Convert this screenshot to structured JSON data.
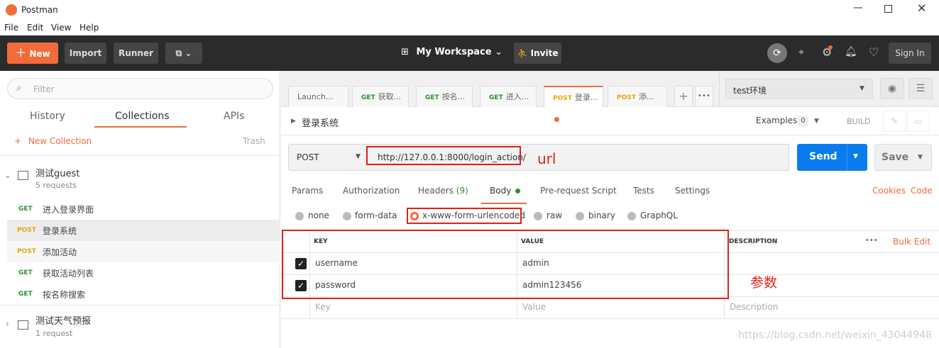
{
  "window": {
    "title": "Postman"
  },
  "menu": [
    "File",
    "Edit",
    "View",
    "Help"
  ],
  "header": {
    "new_label": "New",
    "import_label": "Import",
    "runner_label": "Runner",
    "workspace_label": "My Workspace",
    "invite_label": "Invite",
    "signin_label": "Sign In"
  },
  "sidebar": {
    "filter_placeholder": "Filter",
    "tabs": [
      "History",
      "Collections",
      "APIs"
    ],
    "new_collection": "New Collection",
    "trash": "Trash",
    "collections": [
      {
        "name": "测试guest",
        "count": "5 requests"
      },
      {
        "name": "测试天气预报",
        "count": "1 request"
      }
    ],
    "requests": [
      {
        "method": "GET",
        "name": "进入登录界面"
      },
      {
        "method": "POST",
        "name": "登录系统"
      },
      {
        "method": "POST",
        "name": "添加活动"
      },
      {
        "method": "GET",
        "name": "获取活动列表"
      },
      {
        "method": "GET",
        "name": "按名称搜索"
      }
    ]
  },
  "tabs": [
    {
      "method": "",
      "label": "Launch..."
    },
    {
      "method": "GET",
      "label": "获取..."
    },
    {
      "method": "GET",
      "label": "按名..."
    },
    {
      "method": "GET",
      "label": "进入..."
    },
    {
      "method": "POST",
      "label": "登录..."
    },
    {
      "method": "POST",
      "label": "添..."
    }
  ],
  "environment": "test环境",
  "request": {
    "title": "登录系统",
    "examples_label": "Examples",
    "examples_count": "0",
    "build_label": "BUILD",
    "method": "POST",
    "url": "http://127.0.0.1:8000/login_action/",
    "send_label": "Send",
    "save_label": "Save"
  },
  "subtabs": {
    "params": "Params",
    "authorization": "Authorization",
    "headers": "Headers",
    "headers_count": "(9)",
    "body": "Body",
    "prerequest": "Pre-request Script",
    "tests": "Tests",
    "settings": "Settings",
    "cookies": "Cookies",
    "code": "Code"
  },
  "body_types": [
    "none",
    "form-data",
    "x-www-form-urlencoded",
    "raw",
    "binary",
    "GraphQL"
  ],
  "table": {
    "headers": {
      "key": "KEY",
      "value": "VALUE",
      "description": "DESCRIPTION"
    },
    "bulk_edit": "Bulk Edit",
    "more": "•••",
    "rows": [
      {
        "key": "username",
        "value": "admin"
      },
      {
        "key": "password",
        "value": "admin123456"
      }
    ],
    "placeholders": {
      "key": "Key",
      "value": "Value",
      "description": "Description"
    }
  },
  "annotations": {
    "url": "url",
    "params": "参数"
  },
  "watermark": "https://blog.csdn.net/weixin_43044948",
  "colors": {
    "accent": "#f26b3a",
    "send": "#097bed",
    "annotation": "#e0201a",
    "header_bg": "#2b2b2b"
  }
}
